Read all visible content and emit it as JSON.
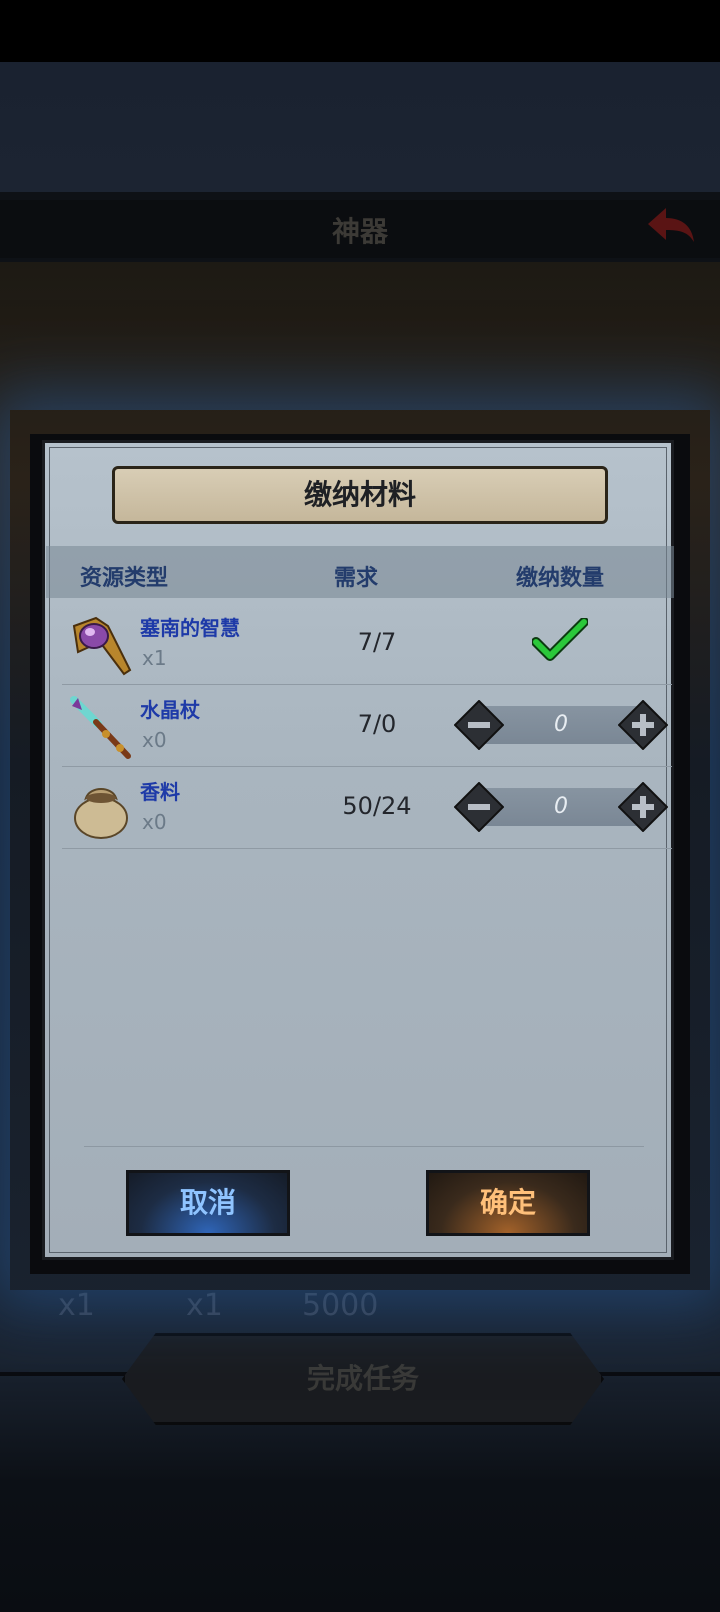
{
  "background": {
    "title": "神器",
    "counts": [
      "x1",
      "x1",
      "5000"
    ],
    "complete_task_label": "完成任务"
  },
  "dialog": {
    "title": "缴纳材料",
    "columns": {
      "resource_type": "资源类型",
      "required": "需求",
      "submit_count": "缴纳数量"
    },
    "items": [
      {
        "name": "塞南的智慧",
        "have": "x1",
        "required": "7/7",
        "status": "complete",
        "icon": "ornate-mace-icon"
      },
      {
        "name": "水晶杖",
        "have": "x0",
        "required": "7/0",
        "submit_value": "0",
        "icon": "crystal-staff-icon"
      },
      {
        "name": "香料",
        "have": "x0",
        "required": "50/24",
        "submit_value": "0",
        "icon": "spice-bag-icon"
      }
    ],
    "cancel_label": "取消",
    "confirm_label": "确定"
  },
  "colors": {
    "item_name": "#1e3aa8",
    "header_text": "#233c6c",
    "cancel_text": "#8fc4ff",
    "confirm_text": "#ffc07a",
    "check": "#2bc83a"
  }
}
